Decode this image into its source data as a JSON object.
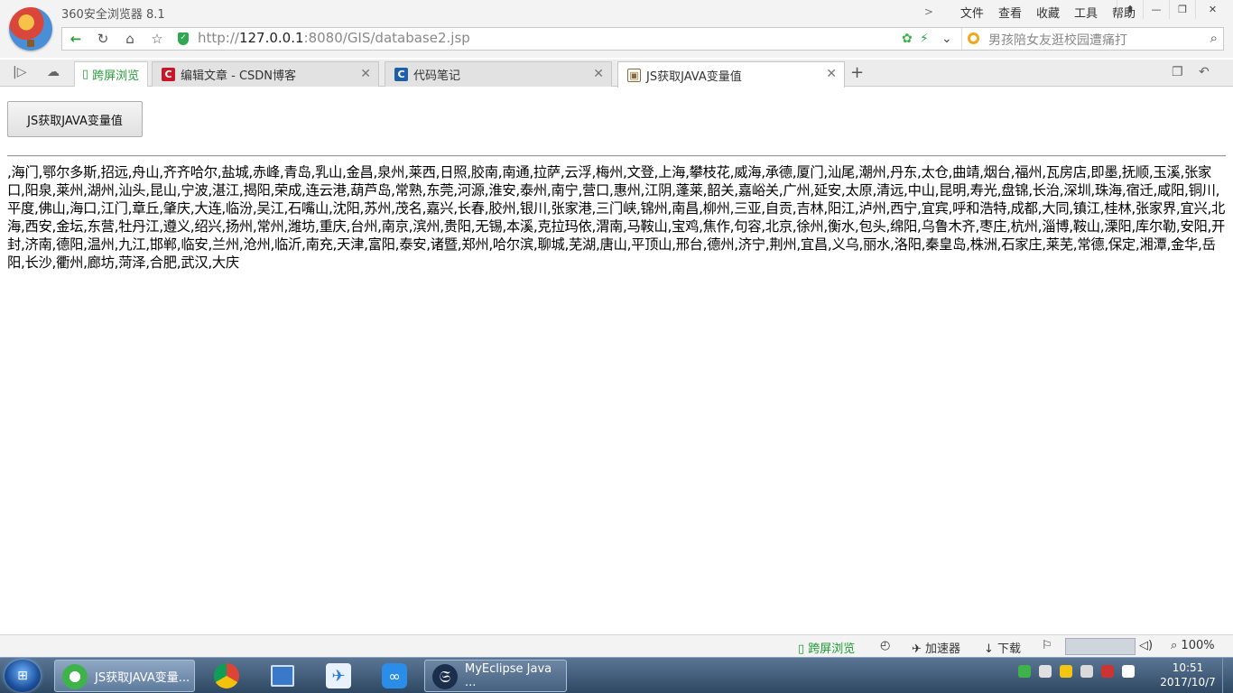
{
  "browser": {
    "title": "360安全浏览器 8.1",
    "menu": [
      "文件",
      "查看",
      "收藏",
      "工具",
      "帮助"
    ],
    "url_scheme": "http://",
    "url_host": "127.0.0.1",
    "url_rest": ":8080/GIS/database2.jsp",
    "search_placeholder": "男孩陪女友逛校园遭痛打"
  },
  "tabs": {
    "split_label": "跨屏浏览",
    "items": [
      {
        "title": "编辑文章 - CSDN博客",
        "fav_color": "#c8162a",
        "fav": "C"
      },
      {
        "title": "代码笔记",
        "fav_color": "#1e5fa8",
        "fav": "C"
      },
      {
        "title": "JS获取JAVA变量值",
        "fav_color": "#8a6a3a",
        "fav": "▣"
      }
    ]
  },
  "page": {
    "button_label": "JS获取JAVA变量值",
    "cities_text": ",海门,鄂尔多斯,招远,舟山,齐齐哈尔,盐城,赤峰,青岛,乳山,金昌,泉州,莱西,日照,胶南,南通,拉萨,云浮,梅州,文登,上海,攀枝花,威海,承德,厦门,汕尾,潮州,丹东,太仓,曲靖,烟台,福州,瓦房店,即墨,抚顺,玉溪,张家口,阳泉,莱州,湖州,汕头,昆山,宁波,湛江,揭阳,荣成,连云港,葫芦岛,常熟,东莞,河源,淮安,泰州,南宁,营口,惠州,江阴,蓬莱,韶关,嘉峪关,广州,延安,太原,清远,中山,昆明,寿光,盘锦,长治,深圳,珠海,宿迁,咸阳,铜川,平度,佛山,海口,江门,章丘,肇庆,大连,临汾,吴江,石嘴山,沈阳,苏州,茂名,嘉兴,长春,胶州,银川,张家港,三门峡,锦州,南昌,柳州,三亚,自贡,吉林,阳江,泸州,西宁,宜宾,呼和浩特,成都,大同,镇江,桂林,张家界,宜兴,北海,西安,金坛,东营,牡丹江,遵义,绍兴,扬州,常州,潍坊,重庆,台州,南京,滨州,贵阳,无锡,本溪,克拉玛依,渭南,马鞍山,宝鸡,焦作,句容,北京,徐州,衡水,包头,绵阳,乌鲁木齐,枣庄,杭州,淄博,鞍山,溧阳,库尔勒,安阳,开封,济南,德阳,温州,九江,邯郸,临安,兰州,沧州,临沂,南充,天津,富阳,泰安,诸暨,郑州,哈尔滨,聊城,芜湖,唐山,平顶山,邢台,德州,济宁,荆州,宜昌,义乌,丽水,洛阳,秦皇岛,株洲,石家庄,莱芜,常德,保定,湘潭,金华,岳阳,长沙,衢州,廊坊,菏泽,合肥,武汉,大庆"
  },
  "statusbar": {
    "split_label": "跨屏浏览",
    "accel_label": "加速器",
    "download_label": "下载",
    "zoom": "100%"
  },
  "taskbar": {
    "task1": "JS获取JAVA变量...",
    "task2": "MyEclipse Java ...",
    "time": "10:51",
    "date": "2017/10/7"
  }
}
